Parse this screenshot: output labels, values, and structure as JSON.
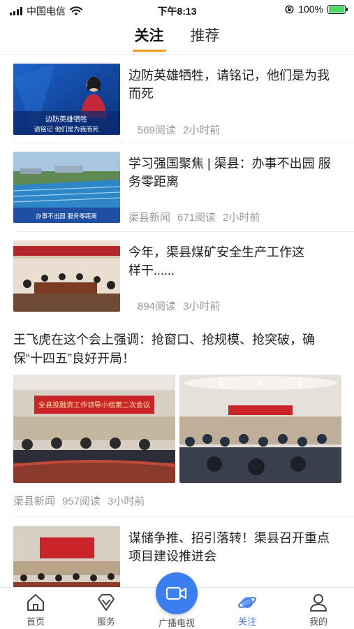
{
  "status_bar": {
    "carrier": "中国电信",
    "time": "下午8:13",
    "battery_percent": "100%",
    "battery_level": 1.0
  },
  "tabs": [
    {
      "label": "关注",
      "active": true
    },
    {
      "label": "推荐",
      "active": false
    }
  ],
  "feed": {
    "items": [
      {
        "title": "边防英雄牺牲，请铭记，他们是为我而死",
        "thumb_caption_line1": "边防英雄牺牲",
        "thumb_caption_line2": "请铭记 他们是为我而死",
        "reads": "569阅读",
        "time": "2小时前"
      },
      {
        "title": "学习强国聚焦 | 渠县：办事不出园 服务零距离",
        "thumb_caption": "办事不出园  服务零距离",
        "source": "渠县新闻",
        "reads": "671阅读",
        "time": "2小时前"
      },
      {
        "title": "今年，渠县煤矿安全生产工作这样干......",
        "reads": "894阅读",
        "time": "3小时前"
      }
    ],
    "big_item": {
      "title": "王飞虎在这个会上强调：抢窗口、抢规模、抢突破，确保“十四五”良好开局！",
      "banner_text": "全县投融资工作领导小组第二次会议",
      "source": "渠县新闻",
      "reads": "957阅读",
      "time": "3小时前"
    },
    "last_item": {
      "title": "谋储争推、招引落转！渠县召开重点项目建设推进会"
    }
  },
  "bottom_nav": [
    {
      "label": "首页",
      "icon": "home-icon",
      "active": false
    },
    {
      "label": "服务",
      "icon": "diamond-icon",
      "active": false
    },
    {
      "label": "广播电视",
      "icon": "video-camera-icon",
      "active": false
    },
    {
      "label": "关注",
      "icon": "planet-icon",
      "active": true
    },
    {
      "label": "我的",
      "icon": "person-icon",
      "active": false
    }
  ],
  "colors": {
    "accent_orange": "#f39a1e",
    "active_blue": "#3b78e7",
    "meta_gray": "#999999"
  }
}
